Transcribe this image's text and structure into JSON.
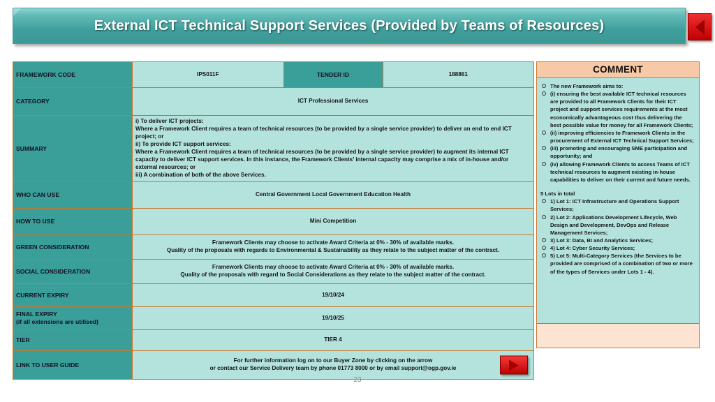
{
  "slide": {
    "title": "External ICT Technical Support Services (Provided by Teams of Resources)",
    "page_number": "23",
    "colors": {
      "banner_teal": "#3f9e9b",
      "label_teal": "#3a9e99",
      "value_mint": "#b4e3de",
      "border_orange": "#c8762c",
      "comment_header_peach": "#f7c9a6",
      "comment_footer_peach": "#fce3d2",
      "arrow_red": "#c00000"
    }
  },
  "icons": {
    "back_arrow": "back-arrow-icon",
    "forward_arrow": "forward-arrow-icon"
  },
  "table": {
    "framework_code": {
      "label": "FRAMEWORK CODE",
      "value": "IPS011F",
      "tender_id_label": "TENDER ID",
      "tender_id_value": "188861"
    },
    "category": {
      "label": "CATEGORY",
      "value": "ICT Professional Services"
    },
    "summary": {
      "label": "SUMMARY",
      "lines": [
        "i) To deliver ICT projects:",
        "Where a Framework Client requires a team of technical resources (to be provided by a single service provider) to deliver an end to end ICT",
        "project; or",
        "ii) To provide ICT support services:",
        "Where a Framework Client requires a team of technical resources (to be provided by a single service provider) to augment its internal ICT",
        "capacity to deliver ICT support services. In this instance, the Framework Clients’ internal capacity may comprise a mix of in-house and/or",
        "external resources; or",
        "iii) A combination of both of the above Services."
      ]
    },
    "who_can_use": {
      "label": "WHO CAN USE",
      "value": "Central Government Local Government Education Health"
    },
    "how_to_use": {
      "label": "HOW TO USE",
      "value": "Mini Competition"
    },
    "green_consideration": {
      "label": "GREEN CONSIDERATION",
      "line1": "Framework Clients may choose to activate Award Criteria at 0% - 30% of available marks.",
      "line2": "Quality of the proposals with regards to Environmental & Sustainability as they relate to the subject matter of the contract."
    },
    "social_consideration": {
      "label": "SOCIAL CONSIDERATION",
      "line1": "Framework Clients may choose to activate Award Criteria at 0% - 30% of available marks.",
      "line2": "Quality of the proposals with regard to Social Considerations as they relate to the subject matter of the contract."
    },
    "current_expiry": {
      "label": "CURRENT EXPIRY",
      "value": "19/10/24"
    },
    "final_expiry": {
      "label_line1": "FINAL EXPIRY",
      "label_line2": "(if all extensions are utilised)",
      "value": "19/10/25"
    },
    "tier": {
      "label": "TIER",
      "value": "TIER 4"
    },
    "link_to_user_guide": {
      "label": "LINK TO USER GUIDE",
      "line1": "For further information log on to our Buyer Zone by clicking on the arrow",
      "line2": "or contact our Service Delivery team by phone  01773 8000 or by email  support@ogp.gov.ie"
    }
  },
  "comment": {
    "header": "COMMENT",
    "aims_items": [
      "The new Framework aims to:",
      "(i) ensuring the best available ICT technical resources are provided to all Framework Clients for their ICT project and support services requirements at the most economically advantageous cost thus delivering the best possible value for money for all Framework Clients;",
      "(ii) improving efficiencies to Framework Clients in the procurement of External ICT Technical Support Services;",
      "(iii) promoting and encouraging SME participation and opportunity; and",
      "(iv) allowing Framework Clients to access Teams of ICT technical resources to augment existing in-house capabilities to deliver on their current and future needs."
    ],
    "lots_heading": "5 Lots in total",
    "lots_items": [
      "1) Lot 1: ICT Infrastructure and Operations Support Services;",
      "2) Lot 2: Applications Development Lifecycle, Web Design and Development, DevOps and Release Management Services;",
      "3) Lot 3: Data, BI and Analytics Services;",
      "4) Lot 4: Cyber Security Services;",
      "5) Lot 5: Multi-Category Services (the Services to be provided are comprised of a combination of two or more of the types of Services under Lots 1 - 4)."
    ]
  }
}
